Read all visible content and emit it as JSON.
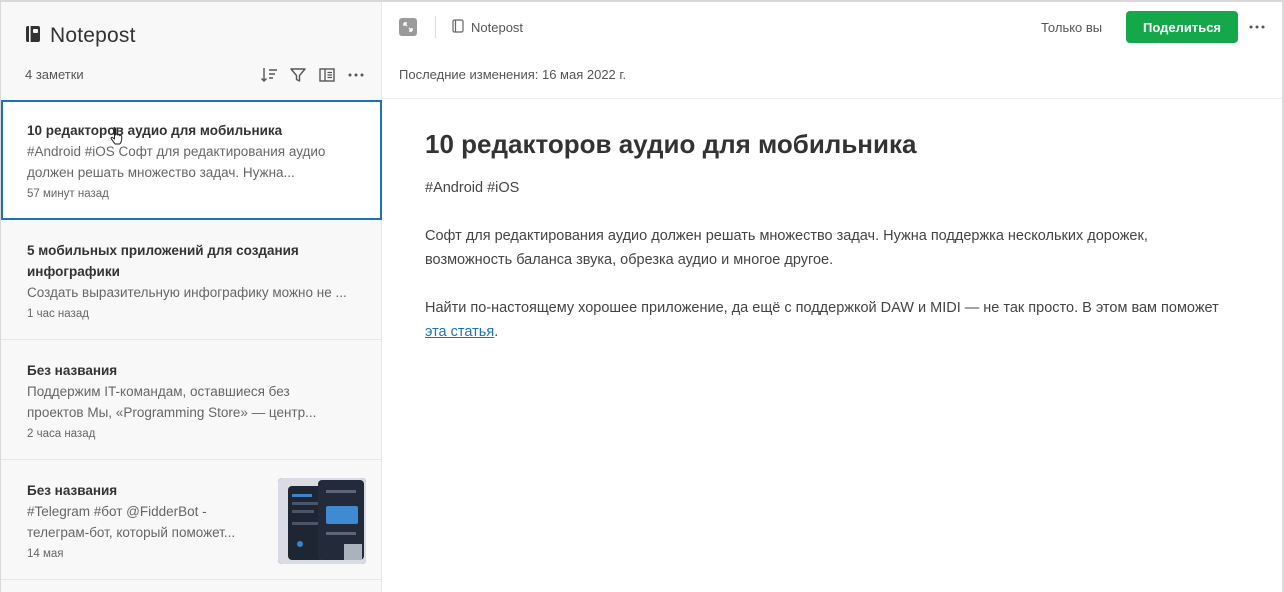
{
  "sidebar": {
    "notebook_title": "Notepost",
    "note_count": "4 заметки",
    "tools": [
      "sort-icon",
      "filter-icon",
      "view-options-icon",
      "more-icon"
    ],
    "notes": [
      {
        "title": "10 редакторов аудио для мобильника",
        "snippet_1": "#Android #iOS Софт для редактирования аудио",
        "snippet_2": "должен решать множество задач. Нужна...",
        "time": "57 минут назад",
        "selected": true
      },
      {
        "title": "5 мобильных приложений для создания",
        "title_2": "инфографики",
        "snippet_1": "Создать выразительную инфографику можно не ...",
        "time": "1 час назад"
      },
      {
        "title": "Без названия",
        "snippet_1": "Поддержим IT-командам, оставшиеся без",
        "snippet_2": "проектов Мы, «Programming Store» — центр...",
        "time": "2 часа назад"
      },
      {
        "title": "Без названия",
        "snippet_1": "#Telegram #бот @FidderBot -",
        "snippet_2": "телеграм-бот, который поможет...",
        "time": "14 мая",
        "has_thumbnail": true
      }
    ]
  },
  "main": {
    "breadcrumb": "Notepost",
    "owner": "Только вы",
    "share_label": "Поделиться",
    "last_edit": "Последние изменения: 16 мая 2022 г.",
    "doc": {
      "title": "10 редакторов аудио для мобильника",
      "tags": "#Android #iOS",
      "p1": "Софт для редактирования аудио должен решать множество задач. Нужна поддержка нескольких дорожек, возможность баланса звука, обрезка аудио и многое другое.",
      "p2_text": "Найти по-настоящему хорошее приложение, да ещё с поддержкой DAW и MIDI — не так просто. В этом вам поможет ",
      "p2_link": "эта статья",
      "p2_end": "."
    }
  },
  "colors": {
    "accent": "#1c73b2",
    "share": "#14a84a"
  }
}
